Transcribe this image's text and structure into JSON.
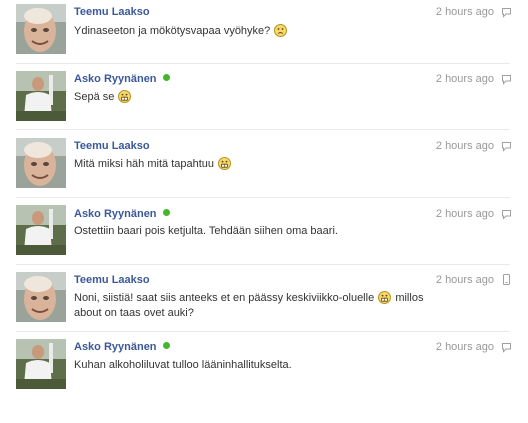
{
  "messages": [
    {
      "author": "Teemu Laakso",
      "online": false,
      "time": "2 hours ago",
      "source_icon": "speech-bubble-icon",
      "parts": [
        "Ydinaseeton ja mökötysvapaa vyöhyke?",
        ""
      ],
      "emoticon": "frown-smiley-icon"
    },
    {
      "author": "Asko Ryynänen",
      "online": true,
      "time": "2 hours ago",
      "source_icon": "speech-bubble-icon",
      "parts": [
        "Sepä se",
        ""
      ],
      "emoticon": "grin-smiley-icon"
    },
    {
      "author": "Teemu Laakso",
      "online": false,
      "time": "2 hours ago",
      "source_icon": "speech-bubble-icon",
      "parts": [
        "Mitä miksi häh mitä tapahtuu",
        ""
      ],
      "emoticon": "grin-smiley-icon"
    },
    {
      "author": "Asko Ryynänen",
      "online": true,
      "time": "2 hours ago",
      "source_icon": "speech-bubble-icon",
      "parts": [
        "Ostettiin baari pois ketjulta. Tehdään siihen oma baari.",
        ""
      ],
      "emoticon": null
    },
    {
      "author": "Teemu Laakso",
      "online": false,
      "time": "2 hours ago",
      "source_icon": "mobile-phone-icon",
      "parts": [
        "Noni, siistiä! saat siis anteeks et en päässy keskiviikko-oluelle",
        "millos about on taas ovet auki?"
      ],
      "emoticon": "grin-smiley-icon"
    },
    {
      "author": "Asko Ryynänen",
      "online": true,
      "time": "2 hours ago",
      "source_icon": "speech-bubble-icon",
      "parts": [
        "Kuhan alkoholiluvat tulloo lääninhallitukselta.",
        ""
      ],
      "emoticon": null
    }
  ],
  "colors": {
    "author": "#3b5998",
    "online": "#42b72a",
    "time": "#999999",
    "divider": "#e9e9e9"
  }
}
